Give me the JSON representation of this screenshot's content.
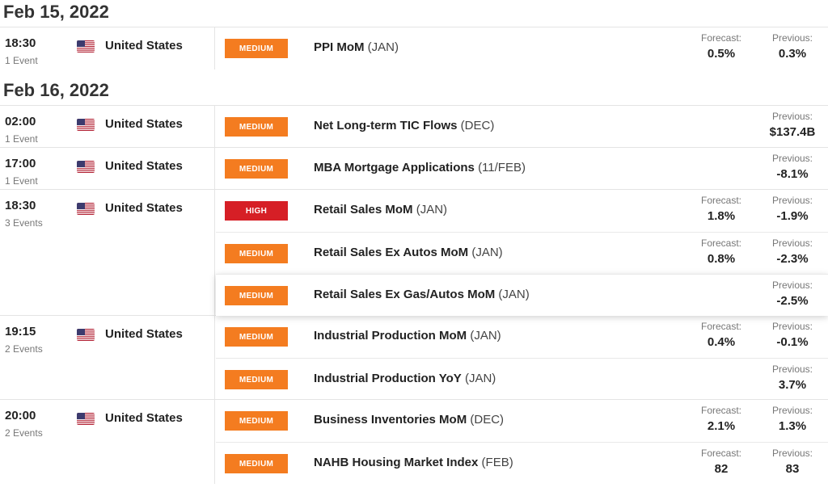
{
  "labels": {
    "forecast": "Forecast:",
    "previous": "Previous:"
  },
  "dates": [
    {
      "date": "Feb 15, 2022",
      "groups": [
        {
          "time": "18:30",
          "count": "1 Event",
          "country": "United States",
          "events": [
            {
              "impact": "MEDIUM",
              "name": "PPI MoM",
              "period": "(JAN)",
              "forecast": "0.5%",
              "previous": "0.3%"
            }
          ]
        }
      ]
    },
    {
      "date": "Feb 16, 2022",
      "groups": [
        {
          "time": "02:00",
          "count": "1 Event",
          "country": "United States",
          "events": [
            {
              "impact": "MEDIUM",
              "name": "Net Long-term TIC Flows",
              "period": "(DEC)",
              "forecast": "",
              "previous": "$137.4B"
            }
          ]
        },
        {
          "time": "17:00",
          "count": "1 Event",
          "country": "United States",
          "events": [
            {
              "impact": "MEDIUM",
              "name": "MBA Mortgage Applications",
              "period": "(11/FEB)",
              "forecast": "",
              "previous": "-8.1%"
            }
          ]
        },
        {
          "time": "18:30",
          "count": "3 Events",
          "country": "United States",
          "events": [
            {
              "impact": "HIGH",
              "name": "Retail Sales MoM",
              "period": "(JAN)",
              "forecast": "1.8%",
              "previous": "-1.9%"
            },
            {
              "impact": "MEDIUM",
              "name": "Retail Sales Ex Autos MoM",
              "period": "(JAN)",
              "forecast": "0.8%",
              "previous": "-2.3%"
            },
            {
              "impact": "MEDIUM",
              "name": "Retail Sales Ex Gas/Autos MoM",
              "period": "(JAN)",
              "forecast": "",
              "previous": "-2.5%",
              "hovered": true
            }
          ]
        },
        {
          "time": "19:15",
          "count": "2 Events",
          "country": "United States",
          "events": [
            {
              "impact": "MEDIUM",
              "name": "Industrial Production MoM",
              "period": "(JAN)",
              "forecast": "0.4%",
              "previous": "-0.1%"
            },
            {
              "impact": "MEDIUM",
              "name": "Industrial Production YoY",
              "period": "(JAN)",
              "forecast": "",
              "previous": "3.7%"
            }
          ]
        },
        {
          "time": "20:00",
          "count": "2 Events",
          "country": "United States",
          "events": [
            {
              "impact": "MEDIUM",
              "name": "Business Inventories MoM",
              "period": "(DEC)",
              "forecast": "2.1%",
              "previous": "1.3%"
            },
            {
              "impact": "MEDIUM",
              "name": "NAHB Housing Market Index",
              "period": "(FEB)",
              "forecast": "82",
              "previous": "83"
            }
          ]
        }
      ]
    }
  ],
  "colors": {
    "medium": "#f47c20",
    "high": "#d61f26",
    "flag_red": "#b22234",
    "flag_blue": "#3c3b6e"
  },
  "icons": {
    "country_flag": "us-flag-icon"
  }
}
